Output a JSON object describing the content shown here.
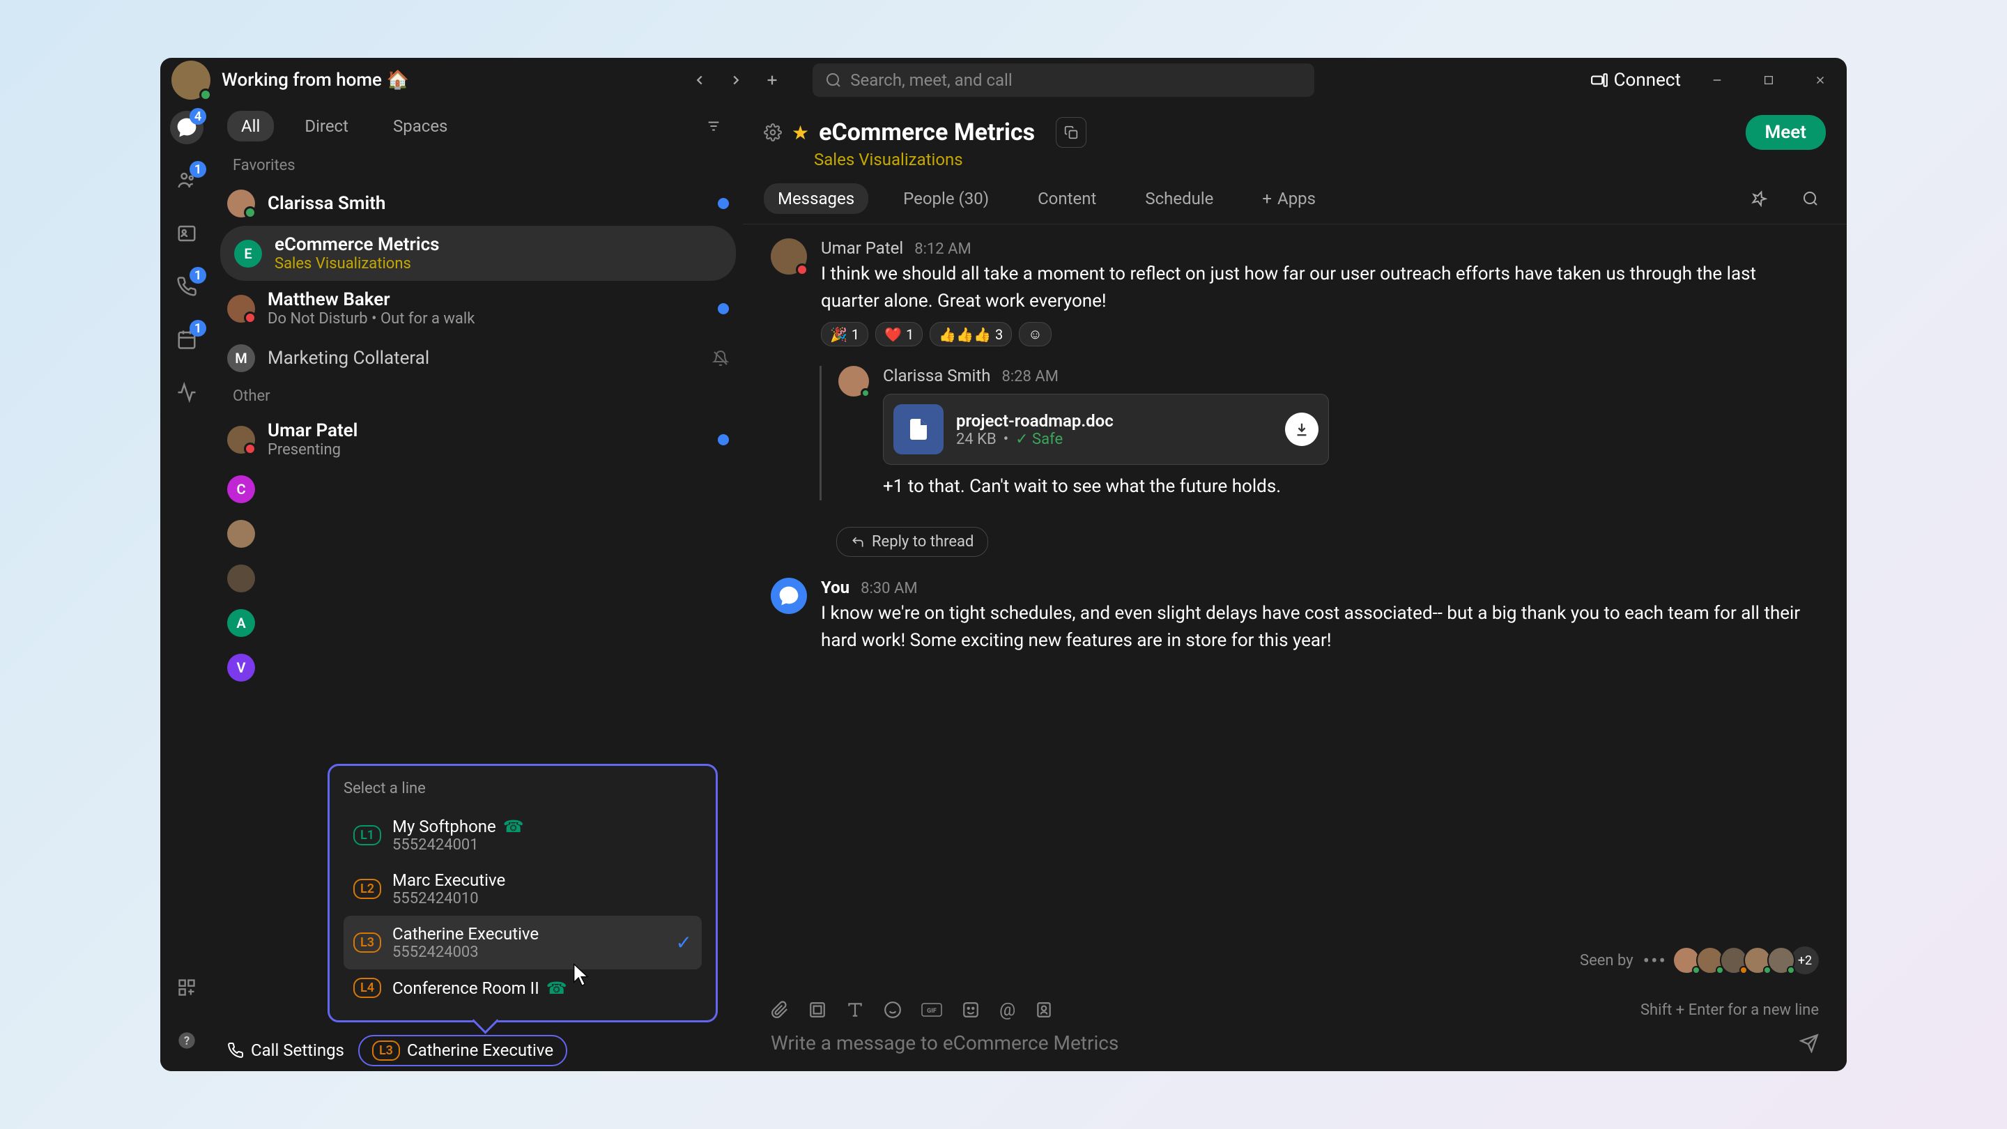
{
  "titleBar": {
    "status": "Working from home 🏠",
    "searchPlaceholder": "Search, meet, and call",
    "connect": "Connect"
  },
  "navRail": {
    "chatBadge": "4",
    "teamsBadge": "1",
    "callBadge": "1",
    "calBadge": "1"
  },
  "sidebar": {
    "tabs": {
      "all": "All",
      "direct": "Direct",
      "spaces": "Spaces"
    },
    "sections": {
      "favorites": "Favorites",
      "other": "Other"
    },
    "items": {
      "clarissa": {
        "name": "Clarissa Smith"
      },
      "ecommerce": {
        "name": "eCommerce Metrics",
        "sub": "Sales Visualizations",
        "letter": "E",
        "color": "#059669"
      },
      "matthew": {
        "name": "Matthew Baker",
        "sub": "Do Not Disturb  •  Out for a walk"
      },
      "marketing": {
        "name": "Marketing Collateral",
        "letter": "M",
        "color": "#555"
      },
      "umar": {
        "name": "Umar Patel",
        "sub": "Presenting"
      },
      "c": {
        "letter": "C",
        "color": "#c026d3"
      },
      "a": {
        "letter": "A",
        "color": "#059669"
      },
      "v": {
        "letter": "V",
        "color": "#7c3aed"
      }
    }
  },
  "content": {
    "spaceName": "eCommerce Metrics",
    "spaceSub": "Sales Visualizations",
    "meet": "Meet",
    "tabs": {
      "messages": "Messages",
      "people": "People (30)",
      "contentTab": "Content",
      "schedule": "Schedule",
      "apps": "Apps"
    }
  },
  "messages": {
    "m1": {
      "author": "Umar Patel",
      "time": "8:12 AM",
      "text": "I think we should all take a moment to reflect on just how far our user outreach efforts have taken us through the last quarter alone. Great work everyone!"
    },
    "reactions": {
      "r1": "🎉",
      "r1c": "1",
      "r2": "❤️",
      "r2c": "1",
      "r3": "👍👍👍",
      "r3c": "3"
    },
    "m2": {
      "author": "Clarissa Smith",
      "time": "8:28 AM",
      "text": "+1 to that. Can't wait to see what the future holds."
    },
    "file": {
      "name": "project-roadmap.doc",
      "size": "24 KB",
      "safe": "Safe"
    },
    "reply": "Reply to thread",
    "m3": {
      "author": "You",
      "time": "8:30 AM",
      "text": "I know we're on tight schedules, and even slight delays have cost associated-- but a big thank you to each team for all their hard work! Some exciting new features are in store for this year!"
    }
  },
  "seenBy": {
    "label": "Seen by",
    "more": "+2"
  },
  "composer": {
    "placeholder": "Write a message to eCommerce Metrics",
    "hint": "Shift + Enter for a new line"
  },
  "bottomBar": {
    "callSettings": "Call Settings",
    "lineBadge": "L3",
    "lineName": "Catherine Executive"
  },
  "popup": {
    "title": "Select a line",
    "lines": {
      "l1": {
        "badge": "L1",
        "name": "My Softphone",
        "num": "5552424001",
        "icon": "📞"
      },
      "l2": {
        "badge": "L2",
        "name": "Marc Executive",
        "num": "5552424010"
      },
      "l3": {
        "badge": "L3",
        "name": "Catherine Executive",
        "num": "5552424003"
      },
      "l4": {
        "badge": "L4",
        "name": "Conference Room II",
        "num": "",
        "icon": "📞"
      }
    }
  }
}
